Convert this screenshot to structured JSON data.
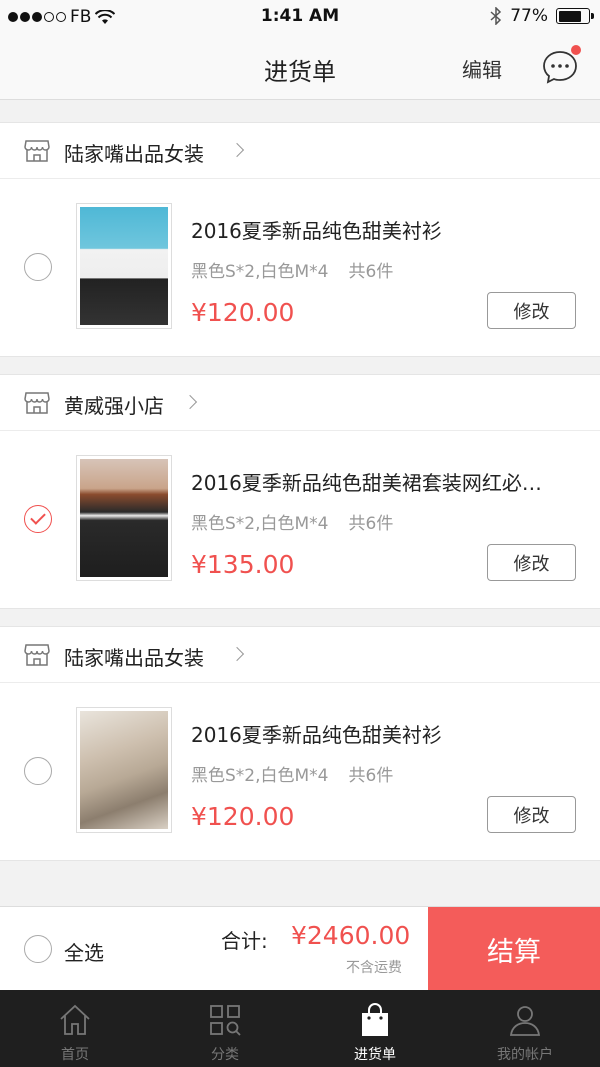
{
  "status": {
    "carrier": "FB",
    "time": "1:41 AM",
    "battery": "77%",
    "battery_level": 0.77
  },
  "nav": {
    "title": "进货单",
    "edit": "编辑"
  },
  "shops": [
    {
      "name": "陆家嘴出品女装",
      "item": {
        "title": "2016夏季新品纯色甜美衬衫",
        "spec": "黑色S*2,白色M*4",
        "count": "共6件",
        "price": "¥120.00",
        "edit": "修改",
        "checked": false
      }
    },
    {
      "name": "黄威强小店",
      "item": {
        "title": "2016夏季新品纯色甜美裙套装网红必…",
        "spec": "黑色S*2,白色M*4",
        "count": "共6件",
        "price": "¥135.00",
        "edit": "修改",
        "checked": true
      }
    },
    {
      "name": "陆家嘴出品女装",
      "item": {
        "title": "2016夏季新品纯色甜美衬衫",
        "spec": "黑色S*2,白色M*4",
        "count": "共6件",
        "price": "¥120.00",
        "edit": "修改",
        "checked": false
      }
    }
  ],
  "checkout": {
    "select_all": "全选",
    "total_label": "合计:",
    "total": "¥2460.00",
    "freight_note": "不含运费",
    "button": "结算"
  },
  "tabs": [
    {
      "label": "首页",
      "icon": "home-icon",
      "active": false
    },
    {
      "label": "分类",
      "icon": "category-grid-icon",
      "active": false
    },
    {
      "label": "进货单",
      "icon": "shopping-bag-icon",
      "active": true
    },
    {
      "label": "我的帐户",
      "icon": "user-icon",
      "active": false
    }
  ],
  "colors": {
    "accent": "#f0514f",
    "checkout_button": "#f45c5a",
    "tabbar": "#1f1f1f"
  }
}
